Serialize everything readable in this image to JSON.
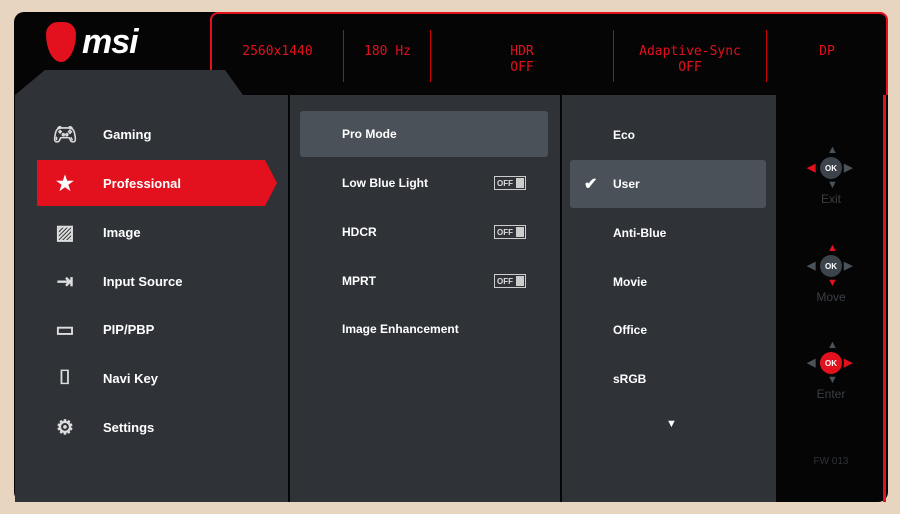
{
  "brand": "msi",
  "status_bar": [
    {
      "label": "2560x1440"
    },
    {
      "label": "180 Hz"
    },
    {
      "label": "HDR",
      "value": "OFF"
    },
    {
      "label": "Adaptive-Sync",
      "value": "OFF"
    },
    {
      "label": "DP"
    }
  ],
  "main_menu": [
    {
      "label": "Gaming",
      "icon": "gamepad-icon"
    },
    {
      "label": "Professional",
      "icon": "star-icon",
      "selected": true
    },
    {
      "label": "Image",
      "icon": "image-icon"
    },
    {
      "label": "Input Source",
      "icon": "input-icon"
    },
    {
      "label": "PIP/PBP",
      "icon": "pip-icon"
    },
    {
      "label": "Navi Key",
      "icon": "navi-key-icon"
    },
    {
      "label": "Settings",
      "icon": "gear-icon"
    }
  ],
  "sub_menu": [
    {
      "label": "Pro Mode",
      "selected": true
    },
    {
      "label": "Low Blue Light",
      "toggle": "OFF"
    },
    {
      "label": "HDCR",
      "toggle": "OFF"
    },
    {
      "label": "MPRT",
      "toggle": "OFF"
    },
    {
      "label": "Image Enhancement"
    }
  ],
  "options": [
    {
      "label": "Eco"
    },
    {
      "label": "User",
      "selected": true
    },
    {
      "label": "Anti-Blue"
    },
    {
      "label": "Movie"
    },
    {
      "label": "Office"
    },
    {
      "label": "sRGB"
    }
  ],
  "keys": [
    {
      "label": "Exit",
      "center": "OK"
    },
    {
      "label": "Move",
      "center": "OK"
    },
    {
      "label": "Enter",
      "center": "OK"
    }
  ],
  "firmware": "FW 013",
  "colors": {
    "accent": "#e3101d",
    "panel": "#2f3338"
  }
}
